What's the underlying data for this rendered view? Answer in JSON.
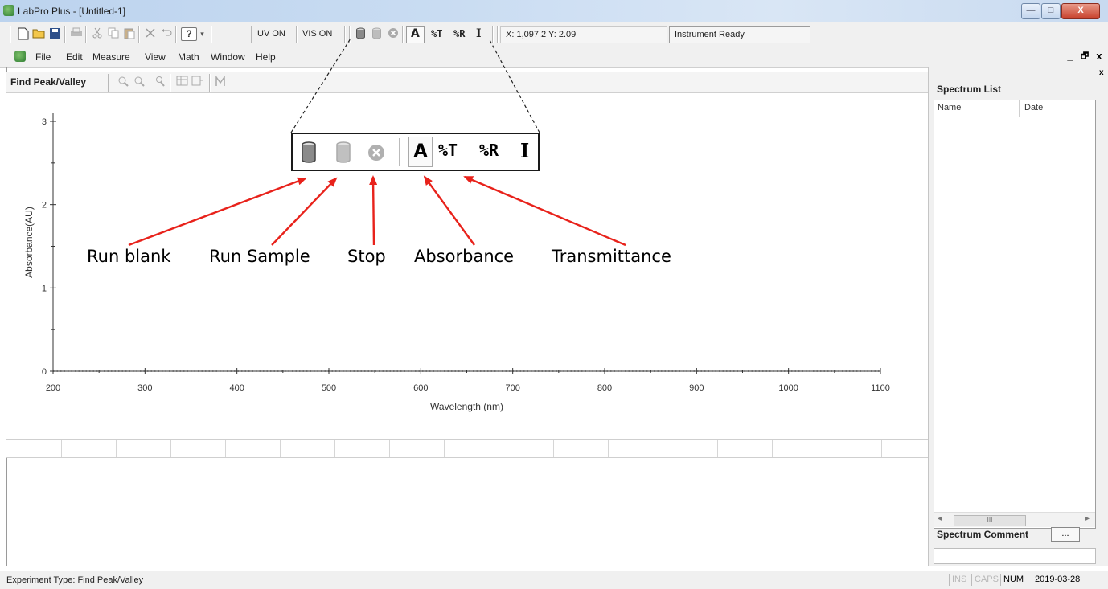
{
  "window": {
    "title": "LabPro Plus - [Untitled-1]",
    "min_glyph": "—",
    "max_glyph": "□",
    "close_glyph": "X"
  },
  "toolbar": {
    "uv_label": "UV ON",
    "vis_label": "VIS ON",
    "abs_label": "A",
    "trans_label": "%T",
    "refl_label": "%R",
    "intensity_label": "I",
    "coords": "X: 1,097.2 Y: 2.09",
    "status": "Instrument Ready",
    "help_glyph": "?"
  },
  "menu": {
    "items": [
      "File",
      "Edit",
      "Measure",
      "View",
      "Math",
      "Window",
      "Help"
    ],
    "mdi_min": "_",
    "mdi_restore": "🗗",
    "mdi_close": "x"
  },
  "toolrow": {
    "title": "Find Peak/Valley"
  },
  "chart_data": {
    "type": "line",
    "xlabel": "Wavelength (nm)",
    "ylabel": "Absorbance(AU)",
    "xlim": [
      200,
      1100
    ],
    "ylim": [
      0,
      3
    ],
    "x_ticks": [
      "200",
      "300",
      "400",
      "500",
      "600",
      "700",
      "800",
      "900",
      "1000",
      "1100"
    ],
    "y_ticks": [
      "0",
      "1",
      "2",
      "3"
    ],
    "series": [
      {
        "x": [
          200,
          1100
        ],
        "values": [
          0,
          0
        ]
      }
    ],
    "grid": false
  },
  "callout": {
    "abs_label": "A",
    "trans_label": "%T",
    "refl_label": "%R",
    "intensity_label": "I",
    "labels": [
      "Run blank",
      "Run Sample",
      "Stop",
      "Absorbance",
      "Transmittance"
    ],
    "arrow_color": "#e8221b"
  },
  "right_panel": {
    "list_title": "Spectrum List",
    "columns": [
      "Name",
      "Date"
    ],
    "scroll_thumb": "III",
    "comment_title": "Spectrum Comment",
    "comment_button": "...",
    "scroll_left": "◂",
    "scroll_right": "▸",
    "panel_close": "x"
  },
  "statusbar": {
    "text": "Experiment Type: Find Peak/Valley",
    "ins": "INS",
    "caps": "CAPS",
    "num": "NUM",
    "date": "2019-03-28"
  }
}
